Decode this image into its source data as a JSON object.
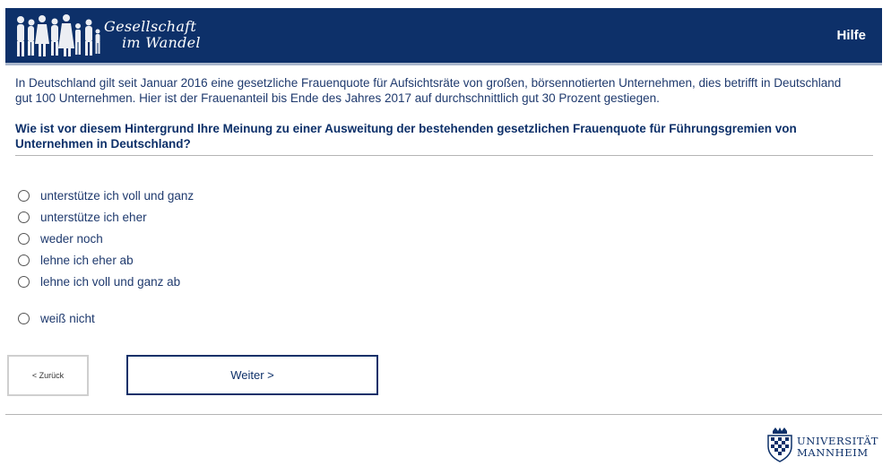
{
  "header": {
    "logo_line1": "Gesellschaft",
    "logo_line2": "im Wandel",
    "help_label": "Hilfe",
    "background_color": "#0d3069"
  },
  "intro": "In Deutschland gilt seit Januar 2016 eine gesetzliche Frauenquote für Aufsichtsräte von großen, börsennotierten Unternehmen, dies betrifft in Deutschland gut 100 Unternehmen. Hier ist der Frauenanteil bis Ende des Jahres 2017 auf durchschnittlich gut 30 Prozent gestiegen.",
  "question": "Wie ist vor diesem Hintergrund Ihre Meinung zu einer Ausweitung der bestehenden gesetzlichen Frauenquote für Führungsgremien von Unternehmen in Deutschland?",
  "options": [
    "unterstütze ich voll und ganz",
    "unterstütze ich eher",
    "weder noch",
    "lehne ich eher ab",
    "lehne ich voll und ganz ab",
    "weiß nicht"
  ],
  "nav": {
    "back_label": "< Zurück",
    "next_label": "Weiter >"
  },
  "footer": {
    "university_line1": "UNIVERSITÄT",
    "university_line2": "MANNHEIM"
  }
}
